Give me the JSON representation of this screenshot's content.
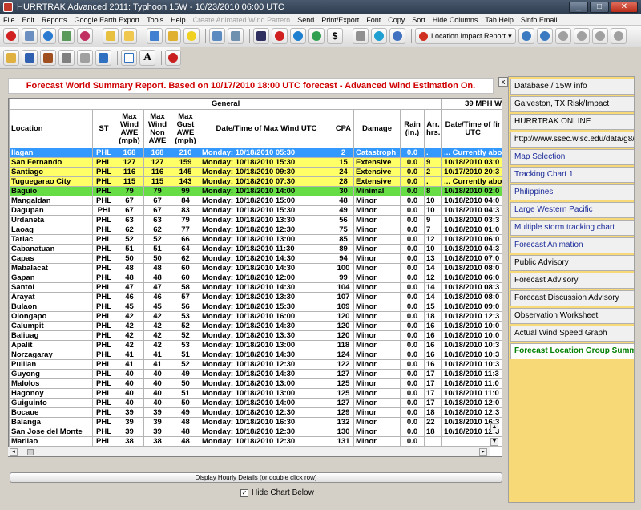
{
  "window": {
    "title": "HURRTRAK Advanced 2011: Typhoon 15W - 10/23/2010 06:00 UTC",
    "minimize": "_",
    "maximize": "□",
    "close": "✕"
  },
  "menu": [
    {
      "label": "File"
    },
    {
      "label": "Edit"
    },
    {
      "label": "Reports"
    },
    {
      "label": "Google Earth Export"
    },
    {
      "label": "Tools"
    },
    {
      "label": "Help"
    },
    {
      "label": "Create Animated Wind Pattern",
      "disabled": true
    },
    {
      "label": "Send"
    },
    {
      "label": "Print/Export"
    },
    {
      "label": "Font"
    },
    {
      "label": "Copy"
    },
    {
      "label": "Sort"
    },
    {
      "label": "Hide Columns"
    },
    {
      "label": "Tab Help"
    },
    {
      "label": "Sinfo Email"
    }
  ],
  "toolbar": {
    "location_impact_report": "Location Impact Report",
    "dropdown_arrow": "▾"
  },
  "report": {
    "title": "Forecast World Summary Report. Based on 10/17/2010 18:00 UTC forecast - Advanced Wind Estimation On.",
    "close": "x"
  },
  "table": {
    "group_general": "General",
    "group_39mph": "39 MPH W",
    "headers": {
      "location": "Location",
      "st": "ST",
      "max_wind": "Max Wind AWE (mph)",
      "max_wind_non": "Max Wind Non AWE",
      "max_gust": "Max Gust AWE (mph)",
      "datetime": "Date/Time of Max Wind UTC",
      "cpa": "CPA",
      "damage": "Damage",
      "rain": "Rain (in.)",
      "arr": "Arr. hrs.",
      "datetime_first": "Date/Time of fir UTC"
    },
    "rows": [
      {
        "loc": "Ilagan",
        "st": "PHL",
        "w": "168",
        "wn": "168",
        "g": "210",
        "dt": "Monday: 10/18/2010 05:30",
        "cpa": "2",
        "dmg": "Catastroph",
        "rain": "0.0",
        "arr": ".",
        "dtf": "... Currently abo",
        "hl": "blue"
      },
      {
        "loc": "San Fernando",
        "st": "PHL",
        "w": "127",
        "wn": "127",
        "g": "159",
        "dt": "Monday: 10/18/2010 15:30",
        "cpa": "15",
        "dmg": "Extensive",
        "rain": "0.0",
        "arr": "9",
        "dtf": "10/18/2010 03:0",
        "hl": "yellow"
      },
      {
        "loc": "Santiago",
        "st": "PHL",
        "w": "116",
        "wn": "116",
        "g": "145",
        "dt": "Monday: 10/18/2010 09:30",
        "cpa": "24",
        "dmg": "Extensive",
        "rain": "0.0",
        "arr": "2",
        "dtf": "10/17/2010 20:3",
        "hl": "yellow"
      },
      {
        "loc": "Tuguegarao City",
        "st": "PHL",
        "w": "115",
        "wn": "115",
        "g": "143",
        "dt": "Monday: 10/18/2010 07:30",
        "cpa": "28",
        "dmg": "Extensive",
        "rain": "0.0",
        "arr": ".",
        "dtf": "... Currently abo",
        "hl": "yellow"
      },
      {
        "loc": "Baguio",
        "st": "PHL",
        "w": "79",
        "wn": "79",
        "g": "99",
        "dt": "Monday: 10/18/2010 14:00",
        "cpa": "30",
        "dmg": "Minimal",
        "rain": "0.0",
        "arr": "8",
        "dtf": "10/18/2010 02:0",
        "hl": "green"
      },
      {
        "loc": "Mangaldan",
        "st": "PHL",
        "w": "67",
        "wn": "67",
        "g": "84",
        "dt": "Monday: 10/18/2010 15:00",
        "cpa": "48",
        "dmg": "Minor",
        "rain": "0.0",
        "arr": "10",
        "dtf": "10/18/2010 04:0",
        "hl": ""
      },
      {
        "loc": "Dagupan",
        "st": "PHI",
        "w": "67",
        "wn": "67",
        "g": "83",
        "dt": "Monday: 10/18/2010 15:30",
        "cpa": "49",
        "dmg": "Minor",
        "rain": "0.0",
        "arr": "10",
        "dtf": "10/18/2010 04:3",
        "hl": ""
      },
      {
        "loc": "Urdaneta",
        "st": "PHL",
        "w": "63",
        "wn": "63",
        "g": "79",
        "dt": "Monday: 10/18/2010 13:30",
        "cpa": "56",
        "dmg": "Minor",
        "rain": "0.0",
        "arr": "9",
        "dtf": "10/18/2010 03:3",
        "hl": ""
      },
      {
        "loc": "Laoag",
        "st": "PHL",
        "w": "62",
        "wn": "62",
        "g": "77",
        "dt": "Monday: 10/18/2010 12:30",
        "cpa": "75",
        "dmg": "Minor",
        "rain": "0.0",
        "arr": "7",
        "dtf": "10/18/2010 01:0",
        "hl": ""
      },
      {
        "loc": "Tarlac",
        "st": "PHL",
        "w": "52",
        "wn": "52",
        "g": "66",
        "dt": "Monday: 10/18/2010 13:00",
        "cpa": "85",
        "dmg": "Minor",
        "rain": "0.0",
        "arr": "12",
        "dtf": "10/18/2010 06:0",
        "hl": ""
      },
      {
        "loc": "Cabanatuan",
        "st": "PHL",
        "w": "51",
        "wn": "51",
        "g": "64",
        "dt": "Monday: 10/18/2010 11:30",
        "cpa": "89",
        "dmg": "Minor",
        "rain": "0.0",
        "arr": "10",
        "dtf": "10/18/2010 04:3",
        "hl": ""
      },
      {
        "loc": "Capas",
        "st": "PHL",
        "w": "50",
        "wn": "50",
        "g": "62",
        "dt": "Monday: 10/18/2010 14:30",
        "cpa": "94",
        "dmg": "Minor",
        "rain": "0.0",
        "arr": "13",
        "dtf": "10/18/2010 07:0",
        "hl": ""
      },
      {
        "loc": "Mabalacat",
        "st": "PHL",
        "w": "48",
        "wn": "48",
        "g": "60",
        "dt": "Monday: 10/18/2010 14:30",
        "cpa": "100",
        "dmg": "Minor",
        "rain": "0.0",
        "arr": "14",
        "dtf": "10/18/2010 08:0",
        "hl": ""
      },
      {
        "loc": "Gapan",
        "st": "PHL",
        "w": "48",
        "wn": "48",
        "g": "60",
        "dt": "Monday: 10/18/2010 12:00",
        "cpa": "99",
        "dmg": "Minor",
        "rain": "0.0",
        "arr": "12",
        "dtf": "10/18/2010 06:0",
        "hl": ""
      },
      {
        "loc": "Santol",
        "st": "PHL",
        "w": "47",
        "wn": "47",
        "g": "58",
        "dt": "Monday: 10/18/2010 14:30",
        "cpa": "104",
        "dmg": "Minor",
        "rain": "0.0",
        "arr": "14",
        "dtf": "10/18/2010 08:3",
        "hl": ""
      },
      {
        "loc": "Arayat",
        "st": "PHL",
        "w": "46",
        "wn": "46",
        "g": "57",
        "dt": "Monday: 10/18/2010 13:30",
        "cpa": "107",
        "dmg": "Minor",
        "rain": "0.0",
        "arr": "14",
        "dtf": "10/18/2010 08:0",
        "hl": ""
      },
      {
        "loc": "Bulaon",
        "st": "PHL",
        "w": "45",
        "wn": "45",
        "g": "56",
        "dt": "Monday: 10/18/2010 15:30",
        "cpa": "109",
        "dmg": "Minor",
        "rain": "0.0",
        "arr": "15",
        "dtf": "10/18/2010 09:0",
        "hl": ""
      },
      {
        "loc": "Olongapo",
        "st": "PHL",
        "w": "42",
        "wn": "42",
        "g": "53",
        "dt": "Monday: 10/18/2010 16:00",
        "cpa": "120",
        "dmg": "Minor",
        "rain": "0.0",
        "arr": "18",
        "dtf": "10/18/2010 12:3",
        "hl": ""
      },
      {
        "loc": "Calumpit",
        "st": "PHL",
        "w": "42",
        "wn": "42",
        "g": "52",
        "dt": "Monday: 10/18/2010 14:30",
        "cpa": "120",
        "dmg": "Minor",
        "rain": "0.0",
        "arr": "16",
        "dtf": "10/18/2010 10:0",
        "hl": ""
      },
      {
        "loc": "Baliuag",
        "st": "PHL",
        "w": "42",
        "wn": "42",
        "g": "52",
        "dt": "Monday: 10/18/2010 13:30",
        "cpa": "120",
        "dmg": "Minor",
        "rain": "0.0",
        "arr": "16",
        "dtf": "10/18/2010 10:0",
        "hl": ""
      },
      {
        "loc": "Apalit",
        "st": "PHL",
        "w": "42",
        "wn": "42",
        "g": "53",
        "dt": "Monday: 10/18/2010 13:00",
        "cpa": "118",
        "dmg": "Minor",
        "rain": "0.0",
        "arr": "16",
        "dtf": "10/18/2010 10:3",
        "hl": ""
      },
      {
        "loc": "Norzagaray",
        "st": "PHL",
        "w": "41",
        "wn": "41",
        "g": "51",
        "dt": "Monday: 10/18/2010 14:30",
        "cpa": "124",
        "dmg": "Minor",
        "rain": "0.0",
        "arr": "16",
        "dtf": "10/18/2010 10:3",
        "hl": ""
      },
      {
        "loc": "Pulilan",
        "st": "PHL",
        "w": "41",
        "wn": "41",
        "g": "52",
        "dt": "Monday: 10/18/2010 12:30",
        "cpa": "122",
        "dmg": "Minor",
        "rain": "0.0",
        "arr": "16",
        "dtf": "10/18/2010 10:3",
        "hl": ""
      },
      {
        "loc": "Guyong",
        "st": "PHL",
        "w": "40",
        "wn": "40",
        "g": "49",
        "dt": "Monday: 10/18/2010 14:30",
        "cpa": "127",
        "dmg": "Minor",
        "rain": "0.0",
        "arr": "17",
        "dtf": "10/18/2010 11:3",
        "hl": ""
      },
      {
        "loc": "Malolos",
        "st": "PHL",
        "w": "40",
        "wn": "40",
        "g": "50",
        "dt": "Monday: 10/18/2010 13:00",
        "cpa": "125",
        "dmg": "Minor",
        "rain": "0.0",
        "arr": "17",
        "dtf": "10/18/2010 11:0",
        "hl": ""
      },
      {
        "loc": "Hagonoy",
        "st": "PHL",
        "w": "40",
        "wn": "40",
        "g": "51",
        "dt": "Monday: 10/18/2010 13:00",
        "cpa": "125",
        "dmg": "Minor",
        "rain": "0.0",
        "arr": "17",
        "dtf": "10/18/2010 11:0",
        "hl": ""
      },
      {
        "loc": "Guiguinto",
        "st": "PHL",
        "w": "40",
        "wn": "40",
        "g": "50",
        "dt": "Monday: 10/18/2010 14:00",
        "cpa": "127",
        "dmg": "Minor",
        "rain": "0.0",
        "arr": "17",
        "dtf": "10/18/2010 12:0",
        "hl": ""
      },
      {
        "loc": "Bocaue",
        "st": "PHL",
        "w": "39",
        "wn": "39",
        "g": "49",
        "dt": "Monday: 10/18/2010 12:30",
        "cpa": "129",
        "dmg": "Minor",
        "rain": "0.0",
        "arr": "18",
        "dtf": "10/18/2010 12:3",
        "hl": ""
      },
      {
        "loc": "Balanga",
        "st": "PHL",
        "w": "39",
        "wn": "39",
        "g": "48",
        "dt": "Monday: 10/18/2010 16:30",
        "cpa": "132",
        "dmg": "Minor",
        "rain": "0.0",
        "arr": "22",
        "dtf": "10/18/2010 16:3",
        "hl": ""
      },
      {
        "loc": "San Jose del Monte",
        "st": "PHL",
        "w": "39",
        "wn": "39",
        "g": "48",
        "dt": "Monday: 10/18/2010 12:30",
        "cpa": "130",
        "dmg": "Minor",
        "rain": "0.0",
        "arr": "18",
        "dtf": "10/18/2010 12:3",
        "hl": ""
      },
      {
        "loc": "Marilao",
        "st": "PHL",
        "w": "38",
        "wn": "38",
        "g": "48",
        "dt": "Monday: 10/18/2010 12:30",
        "cpa": "131",
        "dmg": "Minor",
        "rain": "0.0",
        "arr": "",
        "dtf": "",
        "hl": ""
      }
    ]
  },
  "scroll": {
    "up": "▲",
    "down": "▼",
    "left": "◂",
    "right": "▸"
  },
  "buttons": {
    "display_hourly": "Display Hourly Details (or double click row)",
    "hide_chart": "Hide Chart Below",
    "hide_chart_checked": "✓"
  },
  "right_panel": [
    {
      "label": "Database / 15W info",
      "style": ""
    },
    {
      "label": "Galveston, TX Risk/Impact",
      "style": ""
    },
    {
      "label": "HURRTRAK ONLINE",
      "style": ""
    },
    {
      "label": "http://www.ssec.wisc.edu/data/g8/lat",
      "style": ""
    },
    {
      "label": "Map Selection",
      "style": "blue"
    },
    {
      "label": "Tracking Chart 1",
      "style": "blue"
    },
    {
      "label": "Philippines",
      "style": "blue"
    },
    {
      "label": "Large Western Pacific",
      "style": "blue"
    },
    {
      "label": "Multiple storm tracking chart",
      "style": "blue"
    },
    {
      "label": "Forecast Animation",
      "style": "blue"
    },
    {
      "label": "Public Advisory",
      "style": ""
    },
    {
      "label": "Forecast Advisory",
      "style": ""
    },
    {
      "label": "Forecast Discussion Advisory",
      "style": ""
    },
    {
      "label": "Observation Worksheet",
      "style": ""
    },
    {
      "label": "Actual Wind Speed Graph",
      "style": ""
    },
    {
      "label": "Forecast Location Group Summary",
      "style": "sel"
    }
  ],
  "colors": {
    "highlight_blue": "#3399ff",
    "highlight_yellow": "#ffff66",
    "highlight_green": "#66dd44",
    "panel_bg": "#f8d978",
    "title_red": "#d00000"
  }
}
